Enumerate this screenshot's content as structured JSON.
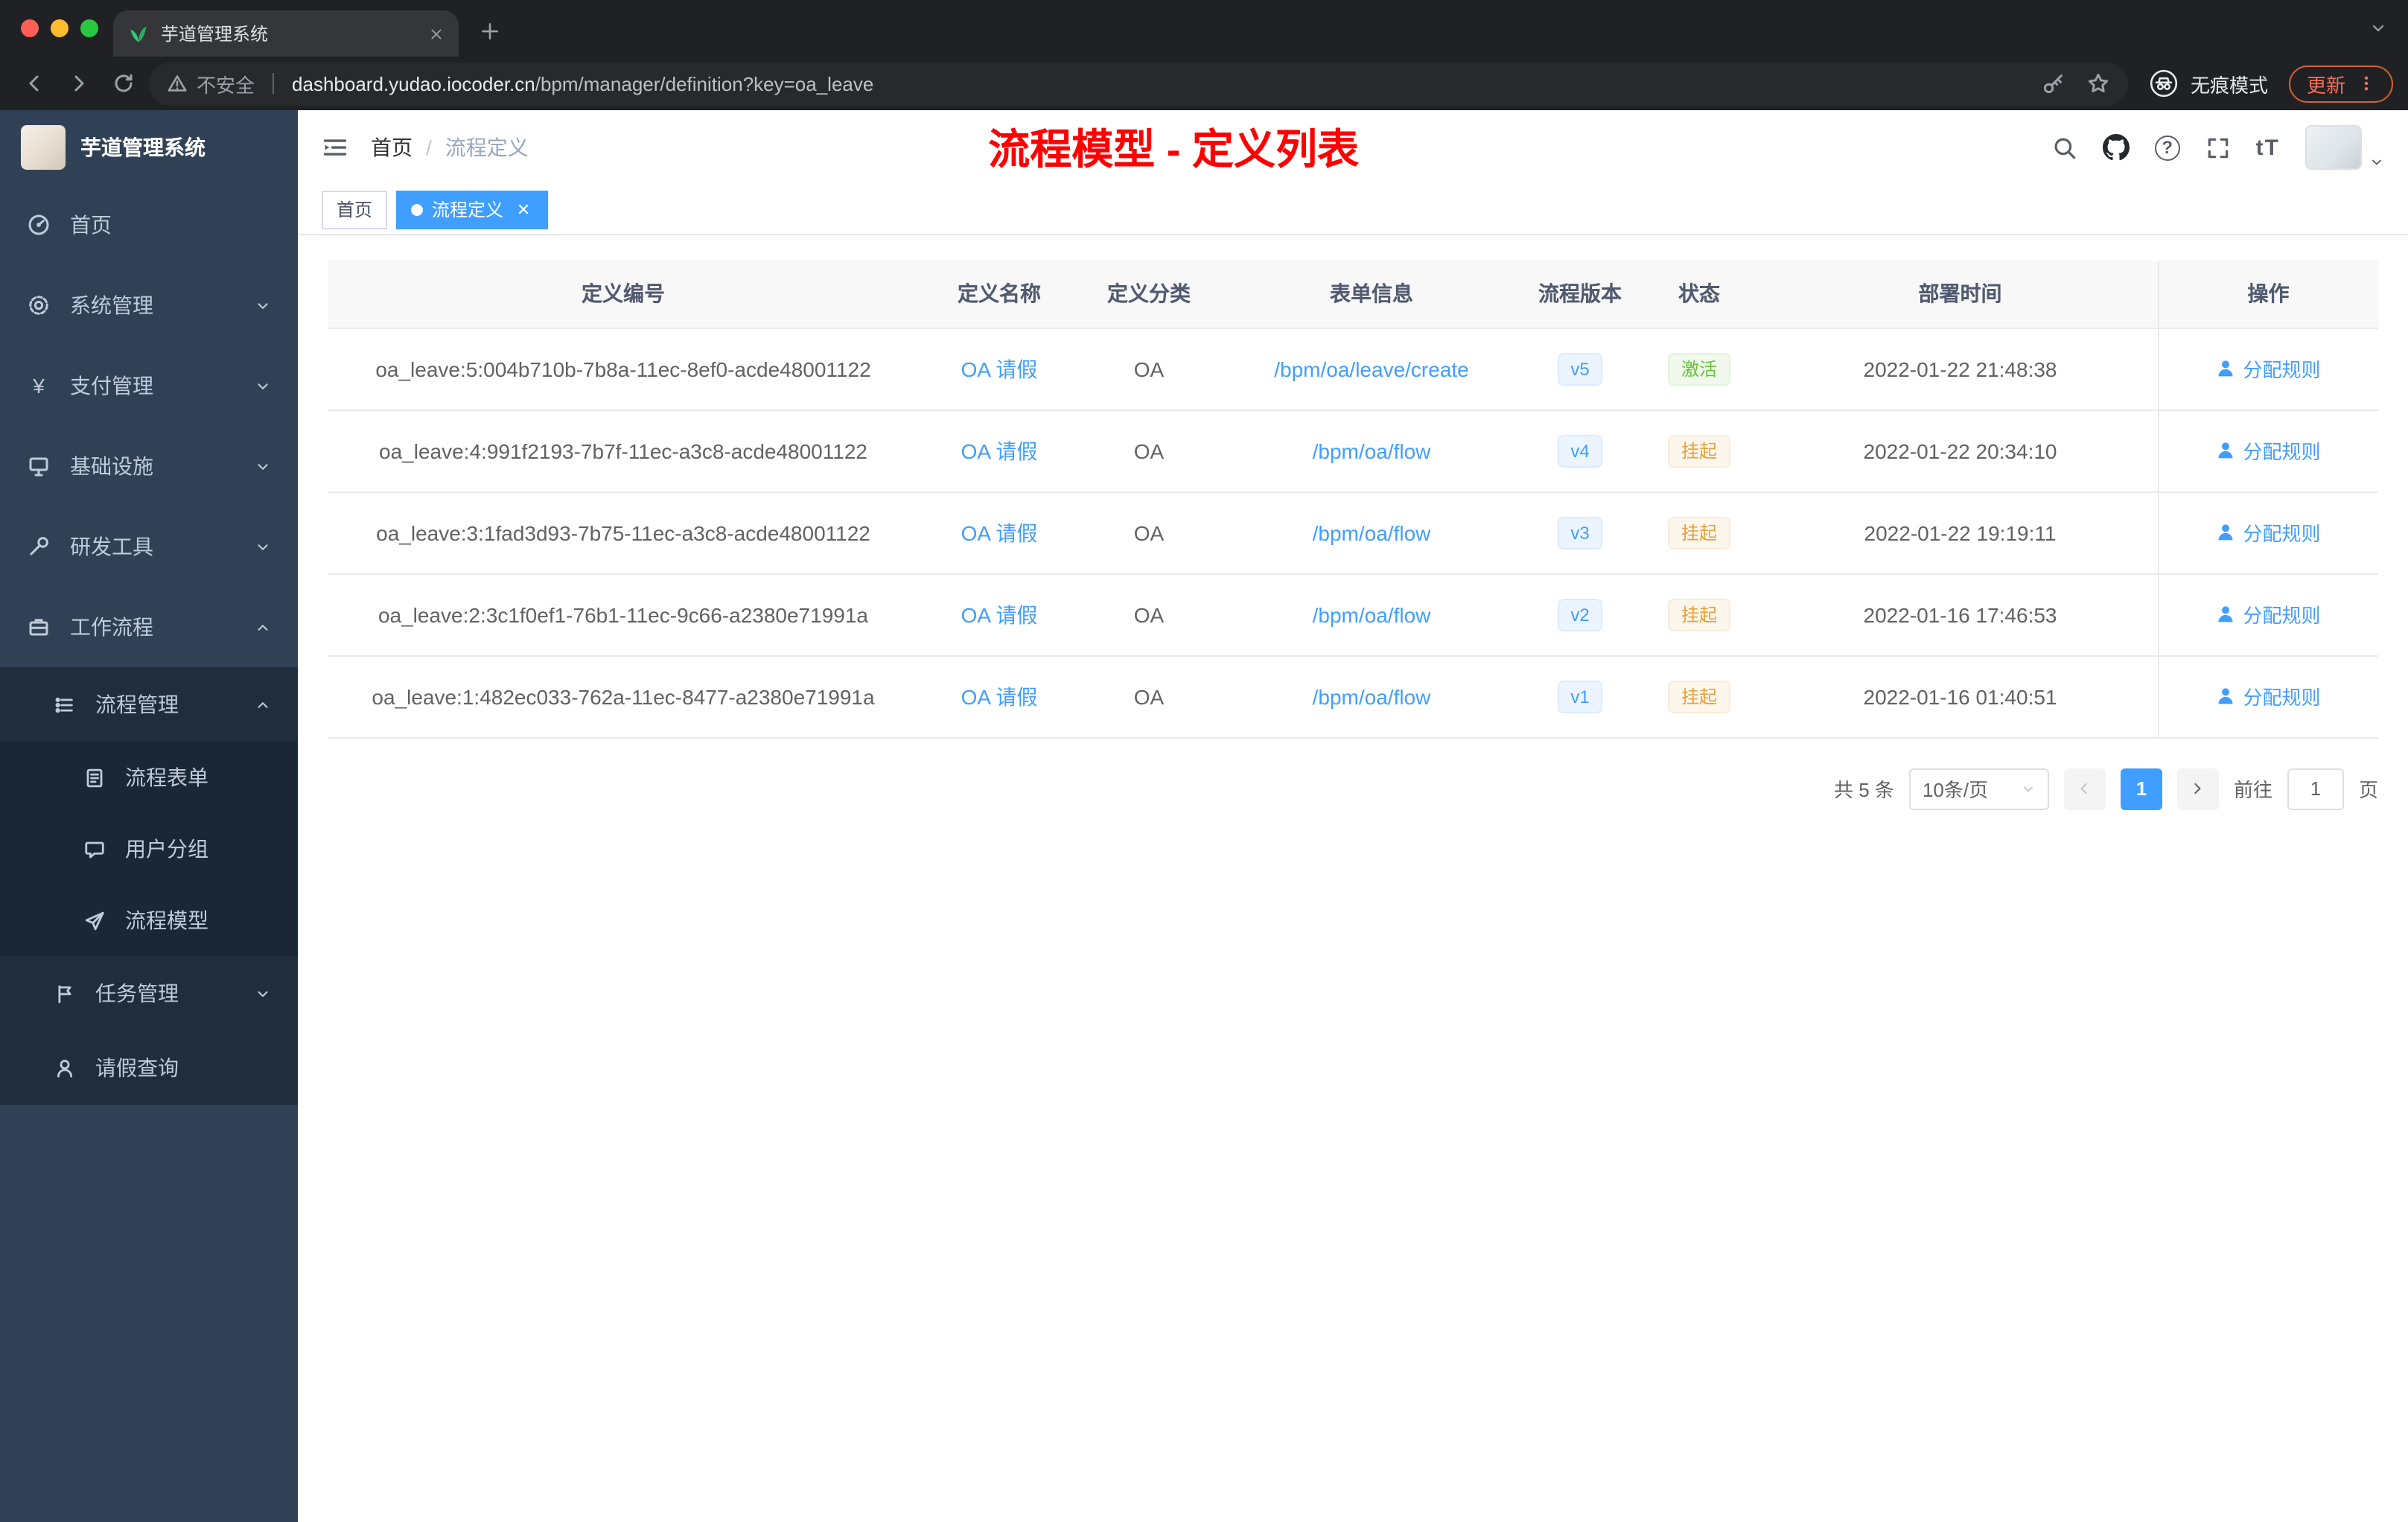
{
  "browser": {
    "tab_title": "芋道管理系统",
    "security_label": "不安全",
    "url_domain": "dashboard.yudao.iocoder.cn",
    "url_path": "/bpm/manager/definition?key=oa_leave",
    "incognito_label": "无痕模式",
    "update_label": "更新"
  },
  "icons": {
    "question_mark": "?",
    "font_size": "tT",
    "yen": "¥"
  },
  "sidebar": {
    "logo_title": "芋道管理系统",
    "items": [
      {
        "label": "首页"
      },
      {
        "label": "系统管理"
      },
      {
        "label": "支付管理"
      },
      {
        "label": "基础设施"
      },
      {
        "label": "研发工具"
      },
      {
        "label": "工作流程"
      }
    ],
    "workflow": {
      "process_mgmt": "流程管理",
      "process_children": [
        {
          "label": "流程表单"
        },
        {
          "label": "用户分组"
        },
        {
          "label": "流程模型"
        }
      ],
      "task_mgmt": "任务管理",
      "leave_query": "请假查询"
    }
  },
  "header": {
    "breadcrumb": {
      "home": "首页",
      "separator": "/",
      "current": "流程定义"
    },
    "annotation": "流程模型 - 定义列表"
  },
  "tags": [
    {
      "label": "首页"
    },
    {
      "label": "流程定义"
    }
  ],
  "table": {
    "headers": [
      "定义编号",
      "定义名称",
      "定义分类",
      "表单信息",
      "流程版本",
      "状态",
      "部署时间",
      "操作"
    ],
    "rows": [
      {
        "id": "oa_leave:5:004b710b-7b8a-11ec-8ef0-acde48001122",
        "name": "OA 请假",
        "category": "OA",
        "form": "/bpm/oa/leave/create",
        "version": "v5",
        "status": "激活",
        "time": "2022-01-22 21:48:38",
        "action": "分配规则"
      },
      {
        "id": "oa_leave:4:991f2193-7b7f-11ec-a3c8-acde48001122",
        "name": "OA 请假",
        "category": "OA",
        "form": "/bpm/oa/flow",
        "version": "v4",
        "status": "挂起",
        "time": "2022-01-22 20:34:10",
        "action": "分配规则"
      },
      {
        "id": "oa_leave:3:1fad3d93-7b75-11ec-a3c8-acde48001122",
        "name": "OA 请假",
        "category": "OA",
        "form": "/bpm/oa/flow",
        "version": "v3",
        "status": "挂起",
        "time": "2022-01-22 19:19:11",
        "action": "分配规则"
      },
      {
        "id": "oa_leave:2:3c1f0ef1-76b1-11ec-9c66-a2380e71991a",
        "name": "OA 请假",
        "category": "OA",
        "form": "/bpm/oa/flow",
        "version": "v2",
        "status": "挂起",
        "time": "2022-01-16 17:46:53",
        "action": "分配规则"
      },
      {
        "id": "oa_leave:1:482ec033-762a-11ec-8477-a2380e71991a",
        "name": "OA 请假",
        "category": "OA",
        "form": "/bpm/oa/flow",
        "version": "v1",
        "status": "挂起",
        "time": "2022-01-16 01:40:51",
        "action": "分配规则"
      }
    ]
  },
  "pagination": {
    "total": "共 5 条",
    "page_size": "10条/页",
    "current_page": "1",
    "goto_label": "前往",
    "goto_value": "1",
    "page_unit": "页"
  },
  "colors": {
    "accent": "#409eff",
    "status_active": "#67c23a",
    "status_suspended": "#e6a23c",
    "annotation": "#ff0000",
    "sidebar_bg": "#304156",
    "submenu_bg": "#1f2d3d"
  }
}
